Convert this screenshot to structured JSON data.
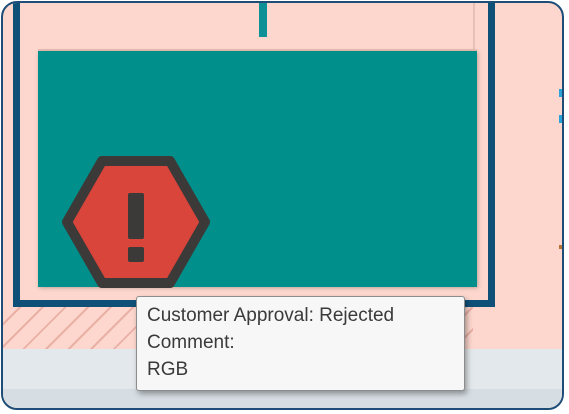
{
  "canvas": {
    "colors": {
      "background": "#fdd7cd",
      "frame_border": "#1e4d78",
      "container_border": "#0f5079",
      "shape_fill": "#008f8a",
      "warning_fill": "#d9453b",
      "warning_outline": "#3b3a38"
    }
  },
  "warning": {
    "icon": "exclamation-hexagon-icon",
    "glyph": "!"
  },
  "tooltip": {
    "lines": [
      "Customer Approval: Rejected",
      "Comment:",
      "RGB"
    ]
  }
}
